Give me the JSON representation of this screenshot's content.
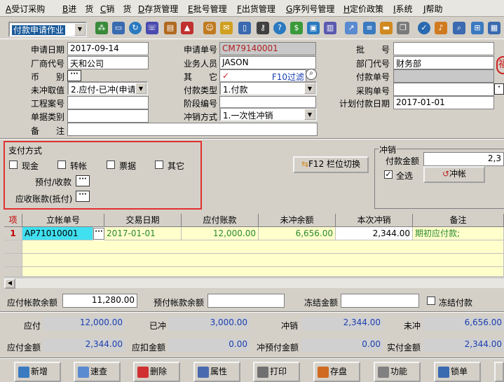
{
  "menu": [
    {
      "hk": "A",
      "label": "受订采购"
    },
    {
      "hk": "B",
      "label": "进　货"
    },
    {
      "hk": "C",
      "label": "销　货"
    },
    {
      "hk": "D",
      "label": "存货管理"
    },
    {
      "hk": "E",
      "label": "批号管理"
    },
    {
      "hk": "F",
      "label": "出货管理"
    },
    {
      "hk": "G",
      "label": "序列号管理"
    },
    {
      "hk": "H",
      "label": "定价政策"
    },
    {
      "hk": "I",
      "label": "系统"
    },
    {
      "hk": "J",
      "label": "帮助"
    }
  ],
  "toolbar": {
    "doc_type": "付款申请作业"
  },
  "header": {
    "apply_date_label": "申请日期",
    "apply_date": "2017-09-14",
    "vendor_label": "厂商代号",
    "vendor": "天和公司",
    "currency_label": "币　　别",
    "writeoff_label": "未冲取值",
    "writeoff": "2.应付-已冲(申请)",
    "project_label": "工程案号",
    "doc_class_label": "单据类别",
    "remark_label": "备　　注",
    "apply_no_label": "申请单号",
    "apply_no": "CM79140001",
    "staff_label": "业务人员",
    "staff": "JASON",
    "other_label": "其　　它",
    "filter_label": "F10过滤",
    "pay_type_label": "付款类型",
    "pay_type": "1.付款",
    "stage_label": "阶段编号",
    "offset_mode_label": "冲销方式",
    "offset_mode": "1.一次性冲销",
    "batch_label": "批　　号",
    "dept_label": "部门代号",
    "dept": "财务部",
    "pay_no_label": "付款单号",
    "purchase_no_label": "采购单号",
    "plan_date_label": "计划付款日期",
    "plan_date": "2017-01-01"
  },
  "payment": {
    "title": "支付方式",
    "cash": "现金",
    "transfer": "转帐",
    "bill": "票据",
    "other": "其它",
    "prepaid_label": "预付/收款",
    "receivable_label": "应收账款(抵付)",
    "f12_label": "F12 栏位切换"
  },
  "offset": {
    "title": "冲销",
    "amount_label": "付款金额",
    "amount": "2,3",
    "select_all": "全选",
    "offset_btn": "冲帐"
  },
  "grid": {
    "headers": [
      "项",
      "立帐单号",
      "交易日期",
      "应付账款",
      "未冲余额",
      "本次冲销",
      "备注"
    ],
    "rows": [
      {
        "no": "1",
        "doc": "AP71010001",
        "date": "2017-01-01",
        "payable": "12,000.00",
        "balance": "6,656.00",
        "offset": "2,344.00",
        "note": "期初应付款;"
      }
    ]
  },
  "summary": {
    "payable_balance_label": "应付帐款余额",
    "payable_balance": "11,280.00",
    "prepaid_balance_label": "预付帐款余额",
    "frozen_label": "冻结金额",
    "frozen_pay_label": "冻结付款",
    "payable_label": "应付",
    "payable": "12,000.00",
    "cleared_label": "已冲",
    "cleared": "3,000.00",
    "writeoff_label": "冲销",
    "writeoff": "2,344.00",
    "uncleared_label": "未冲",
    "uncleared": "6,656.00",
    "pay_amount_label": "应付金额",
    "pay_amount": "2,344.00",
    "deduct_label": "应扣金额",
    "deduct": "0.00",
    "prepaid_offset_label": "冲预付金额",
    "prepaid_offset": "0.00",
    "actual_label": "实付金额",
    "actual": "2,344.00"
  },
  "buttons": [
    "新增",
    "速查",
    "删除",
    "属性",
    "打印",
    "存盘",
    "功能",
    "锁单"
  ],
  "colors": {
    "accent_red": "#e03030",
    "highlight_bar": "#1a5a9a",
    "row_green": "#2a8a2a",
    "row_bg": "#ffffcc"
  }
}
